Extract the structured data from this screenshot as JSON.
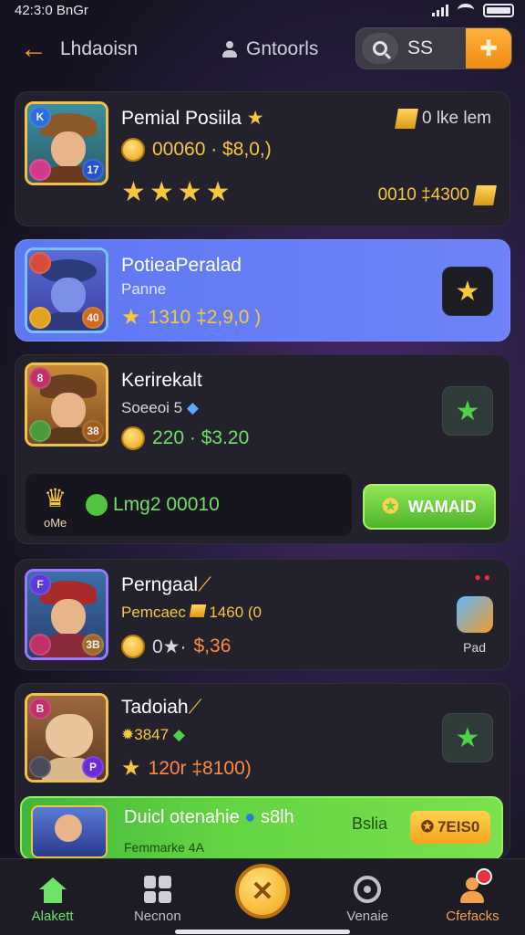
{
  "status": {
    "time": "42:3:0 BnGr"
  },
  "header": {
    "back_label": "Lhdaoisn",
    "center_label": "Gntoorls",
    "search_value": "SS",
    "gold_button_icon": "plus-badge-icon"
  },
  "items": [
    {
      "title": "Pemial Posiila",
      "price": "00060 · $8,0,)",
      "stars": "★★★★",
      "right_top": "0 lke lem",
      "right_bottom": "0010 ‡4300",
      "badges": [
        "K",
        "",
        "17"
      ]
    },
    {
      "title": "PotieaPeralad",
      "sub": "Panne",
      "price": "1310 ‡2,9,0 )",
      "badges": [
        "",
        "",
        "40"
      ]
    },
    {
      "title": "Kerirekalt",
      "sub": "Soeeoi 5",
      "price": "220 · $3.20",
      "badges": [
        "8",
        "",
        "38"
      ]
    },
    {
      "title": "Perngaal",
      "sub": "Pemcaec",
      "sub_value": "1460 (0",
      "price_a": "0★·",
      "price_b": "$,36",
      "right_label": "Pad",
      "badges": [
        "F",
        "",
        "3B"
      ]
    },
    {
      "title": "Tadoiah",
      "sub": "3847",
      "price": "120r ‡8100)",
      "badges": [
        "B",
        "",
        "P"
      ]
    }
  ],
  "reward": {
    "label": "Lmg2 00010",
    "caption": "oMe",
    "button": "WAMAID"
  },
  "promo": {
    "title": "Duicl otenahie",
    "title_tail": "s8lh",
    "middle": "Bslia",
    "button": "7EIS0",
    "sub": "Femmarke 4A"
  },
  "nav": [
    {
      "label": "Alakett",
      "icon": "home-icon"
    },
    {
      "label": "Necnon",
      "icon": "grid-icon"
    },
    {
      "label": "",
      "icon": "close-icon"
    },
    {
      "label": "Venaie",
      "icon": "target-icon"
    },
    {
      "label": "Cfefacks",
      "icon": "profile-icon"
    }
  ],
  "colors": {
    "accent_gold": "#f7c73d",
    "accent_green": "#6fe06a",
    "highlight_blue": "#6e83f7"
  }
}
